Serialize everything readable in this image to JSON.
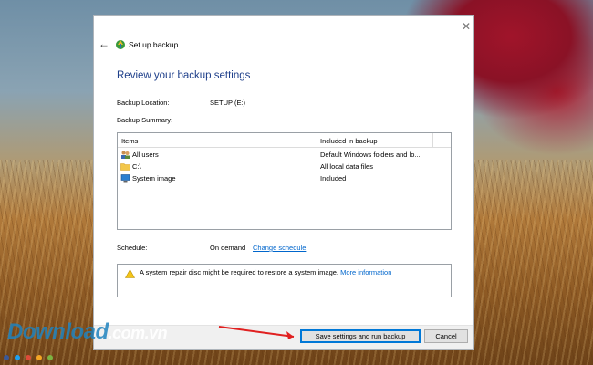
{
  "window": {
    "title": "Set up backup",
    "heading": "Review your backup settings"
  },
  "settings": {
    "location_label": "Backup Location:",
    "location_value": "SETUP (E:)",
    "summary_label": "Backup Summary:"
  },
  "summary_table": {
    "headers": [
      "Items",
      "Included in backup"
    ],
    "rows": [
      {
        "icon": "users-icon",
        "item": "All users",
        "included": "Default Windows folders and lo..."
      },
      {
        "icon": "folder-icon",
        "item": "C:\\",
        "included": "All local data files"
      },
      {
        "icon": "computer-icon",
        "item": "System image",
        "included": "Included"
      }
    ]
  },
  "schedule": {
    "label": "Schedule:",
    "value": "On demand",
    "link": "Change schedule"
  },
  "warning": {
    "text": "A system repair disc might be required to restore a system image.",
    "link": "More information"
  },
  "buttons": {
    "primary": "Save settings and run backup",
    "cancel": "Cancel"
  },
  "watermark": {
    "text": "Download",
    "suffix": ".com.vn"
  },
  "colors": {
    "heading": "#1e3f8a",
    "link": "#0066cc",
    "arrow": "#e02020"
  }
}
